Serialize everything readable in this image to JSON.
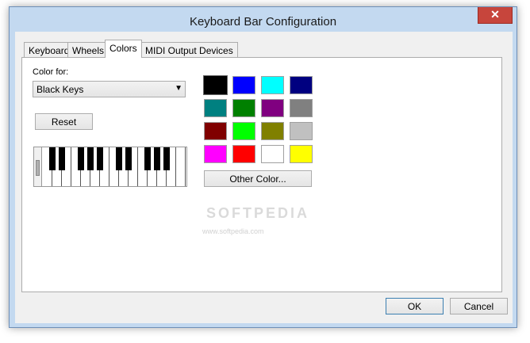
{
  "window": {
    "title": "Keyboard Bar Configuration",
    "close_glyph": "✕"
  },
  "tabs": [
    {
      "label": "Keyboard",
      "active": false
    },
    {
      "label": "Wheels",
      "active": false
    },
    {
      "label": "Colors",
      "active": true
    },
    {
      "label": "MIDI Output Devices",
      "active": false
    }
  ],
  "colors_page": {
    "color_for_label": "Color for:",
    "color_for_value": "Black Keys",
    "reset_label": "Reset",
    "other_color_label": "Other Color...",
    "swatches": [
      {
        "color": "#000000",
        "selected": true
      },
      {
        "color": "#0000ff",
        "selected": false
      },
      {
        "color": "#00ffff",
        "selected": false
      },
      {
        "color": "#000080",
        "selected": false
      },
      {
        "color": "#008080",
        "selected": false
      },
      {
        "color": "#008000",
        "selected": false
      },
      {
        "color": "#800080",
        "selected": false
      },
      {
        "color": "#808080",
        "selected": false
      },
      {
        "color": "#800000",
        "selected": false
      },
      {
        "color": "#00ff00",
        "selected": false
      },
      {
        "color": "#808000",
        "selected": false
      },
      {
        "color": "#c0c0c0",
        "selected": false
      },
      {
        "color": "#ff00ff",
        "selected": false
      },
      {
        "color": "#ff0000",
        "selected": false
      },
      {
        "color": "#ffffff",
        "selected": false
      },
      {
        "color": "#ffff00",
        "selected": false
      }
    ]
  },
  "watermark": {
    "text": "SOFTPEDIA",
    "url": "www.softpedia.com"
  },
  "footer": {
    "ok_label": "OK",
    "cancel_label": "Cancel"
  }
}
